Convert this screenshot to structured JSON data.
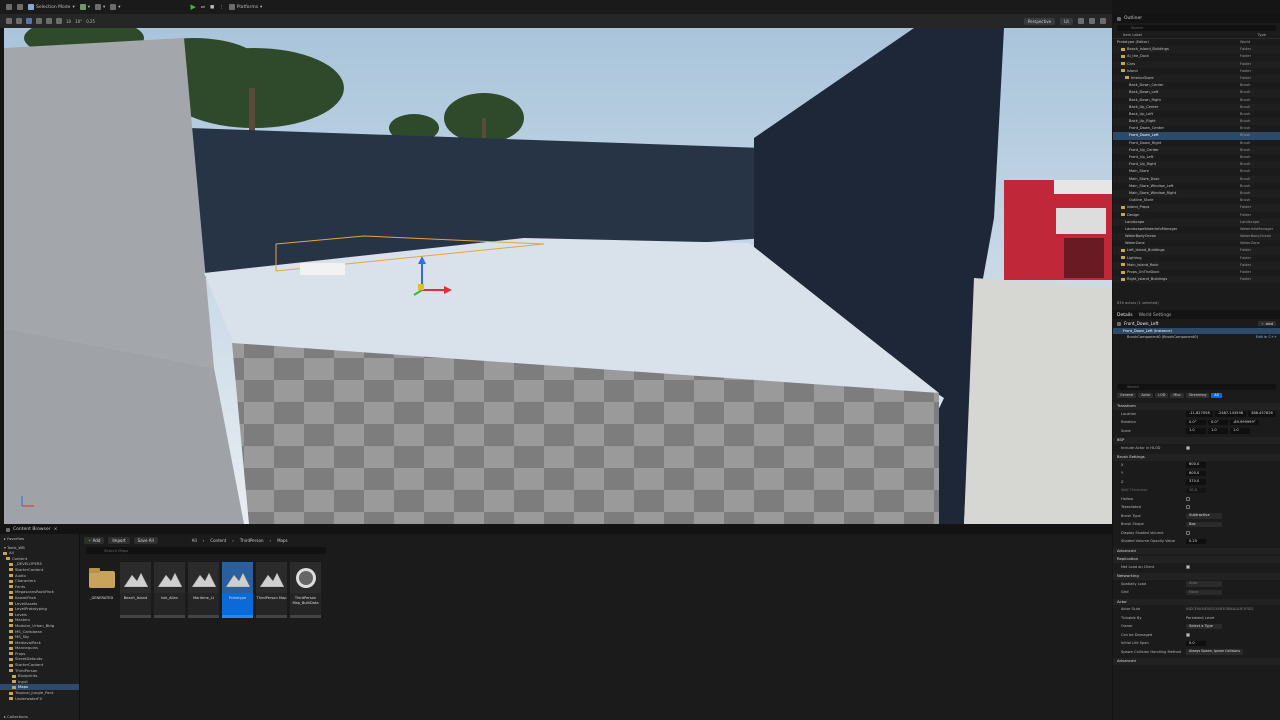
{
  "toolbar": {
    "mode": "Selection Mode",
    "platforms": "Platforms"
  },
  "viewport": {
    "perspective": "Perspective",
    "lit": "Lit",
    "snap_values": [
      "10",
      "10°",
      "0.25"
    ]
  },
  "content_browser": {
    "tab": "Content Browser",
    "add": "Add",
    "import": "Import",
    "save_all": "Save All",
    "crumbs": [
      "All",
      "Content",
      "ThirdPerson",
      "Maps"
    ],
    "search_placeholder": "Search Maps",
    "favorites": "Favorites",
    "project": "Tools_WB",
    "tree": [
      "All",
      "Content",
      "_DEVELOPERS",
      "StarterContent",
      "Audio",
      "Characters",
      "Fonts",
      "MegascansRockPack",
      "KawaiiPack",
      "LevelAssets",
      "LevelPrototyping",
      "Levels",
      "Masters",
      "Modular_Urban_Bldg",
      "MS_Caribbean",
      "MS_Sky",
      "MedievalPack",
      "Mannequins",
      "Props",
      "StreetDefaults",
      "StarterContent",
      "ThirdPerson",
      "Blueprints",
      "Input",
      "Maps",
      "Tropical_Jungle_Pack",
      "UnderwaterFX"
    ],
    "tree_selected_index": 24,
    "collections": "Collections",
    "assets": [
      {
        "label": "_GENERATED",
        "kind": "folder"
      },
      {
        "label": "Beach_Island",
        "kind": "map"
      },
      {
        "label": "Isle_Alien",
        "kind": "map"
      },
      {
        "label": "Maritime_Lt",
        "kind": "map"
      },
      {
        "label": "Prototype",
        "kind": "map",
        "selected": true
      },
      {
        "label": "ThirdPerson Map",
        "kind": "map"
      },
      {
        "label": "ThirdPerson Map_BuiltData",
        "kind": "data"
      }
    ]
  },
  "outliner": {
    "tab": "Outliner",
    "search_placeholder": "Search",
    "col_label": "Item Label",
    "col_type": "Type",
    "rows": [
      {
        "n": "Prototype (Editor)",
        "t": "World",
        "d": 0
      },
      {
        "n": "Beach_Island_Buildings",
        "t": "Folder",
        "d": 1
      },
      {
        "n": "AI_the_Dock",
        "t": "Folder",
        "d": 1
      },
      {
        "n": "Cars",
        "t": "Folder",
        "d": 1
      },
      {
        "n": "Island",
        "t": "Folder",
        "d": 1
      },
      {
        "n": "InteriorStore",
        "t": "Folder",
        "d": 2
      },
      {
        "n": "Back_Down_Center",
        "t": "Brush",
        "d": 3
      },
      {
        "n": "Back_Down_Left",
        "t": "Brush",
        "d": 3
      },
      {
        "n": "Back_Down_Right",
        "t": "Brush",
        "d": 3
      },
      {
        "n": "Back_Up_Center",
        "t": "Brush",
        "d": 3
      },
      {
        "n": "Back_Up_Left",
        "t": "Brush",
        "d": 3
      },
      {
        "n": "Back_Up_Right",
        "t": "Brush",
        "d": 3
      },
      {
        "n": "Front_Down_Center",
        "t": "Brush",
        "d": 3
      },
      {
        "n": "Front_Down_Left",
        "t": "Brush",
        "d": 3,
        "sel": true
      },
      {
        "n": "Front_Down_Right",
        "t": "Brush",
        "d": 3
      },
      {
        "n": "Front_Up_Center",
        "t": "Brush",
        "d": 3
      },
      {
        "n": "Front_Up_Left",
        "t": "Brush",
        "d": 3
      },
      {
        "n": "Front_Up_Right",
        "t": "Brush",
        "d": 3
      },
      {
        "n": "Main_Store",
        "t": "Brush",
        "d": 3
      },
      {
        "n": "Main_Store_Door",
        "t": "Brush",
        "d": 3
      },
      {
        "n": "Main_Store_Window_Left",
        "t": "Brush",
        "d": 3
      },
      {
        "n": "Main_Store_Window_Right",
        "t": "Brush",
        "d": 3
      },
      {
        "n": "Outline_Store",
        "t": "Brush",
        "d": 3
      },
      {
        "n": "Island_Props",
        "t": "Folder",
        "d": 1
      },
      {
        "n": "Design",
        "t": "Folder",
        "d": 1
      },
      {
        "n": "Landscape",
        "t": "Landscape",
        "d": 2
      },
      {
        "n": "LandscapeWaterInfoManager",
        "t": "WaterInfoManager",
        "d": 2
      },
      {
        "n": "WaterBodyOcean",
        "t": "WaterBodyOcean",
        "d": 2
      },
      {
        "n": "WaterZone",
        "t": "WaterZone",
        "d": 2
      },
      {
        "n": "Left_Island_Buildings",
        "t": "Folder",
        "d": 1
      },
      {
        "n": "Lighting",
        "t": "Folder",
        "d": 1
      },
      {
        "n": "Main_Island_Rock",
        "t": "Folder",
        "d": 1
      },
      {
        "n": "Props_OnTheDock",
        "t": "Folder",
        "d": 1
      },
      {
        "n": "Right_Island_Buildings",
        "t": "Folder",
        "d": 1
      }
    ],
    "footer": "630 actors (1 selected)"
  },
  "details": {
    "tab": "Details",
    "tab2": "World Settings",
    "actor": "Front_Down_Left",
    "add": "Add",
    "instance": "Front_Down_Left (Instance)",
    "component": "BrushComponent0 (BrushComponent0)",
    "edit_link": "Edit in C++",
    "search_placeholder": "Search",
    "filters": [
      "General",
      "Actor",
      "LOD",
      "Misc",
      "Streaming",
      "All"
    ],
    "transform": "Transform",
    "location_label": "Location",
    "location": [
      "-11.827058",
      "-2487.143598",
      "388.457826"
    ],
    "rotation_label": "Rotation",
    "rotation": [
      "0.0°",
      "0.0°",
      "-89.999999°"
    ],
    "scale_label": "Scale",
    "scale": [
      "1.0",
      "1.0",
      "1.0"
    ],
    "brush_sec": "BSP",
    "include_actor": "Include Actor in HLOD",
    "brush_settings": "Brush Settings",
    "x_label": "X",
    "x": "600.0",
    "y_label": "Y",
    "y": "600.0",
    "z_label": "Z",
    "z": "370.0",
    "wall_label": "Wall Thickness",
    "wall": "10.0",
    "hollow": "Hollow",
    "tessellated": "Tessellated",
    "brush_type_label": "Brush Type",
    "brush_type": "Subtractive",
    "shape_label": "Brush Shape",
    "shape": "Box",
    "display_label": "Display Shaded Volume",
    "opacity_label": "Shaded Volume Opacity Value",
    "opacity": "0.25",
    "advanced": "Advanced",
    "replication": "Replication",
    "net_load": "Net Load on Client",
    "networking": "Networking",
    "spatial_label": "Spatially Load",
    "spatial": "Auto",
    "grid_label": "Grid",
    "grid": "None",
    "actor_sec": "Actor",
    "guid_label": "Actor Guid",
    "guid": "64DCE9A34E0ED7A5D3C8B4A1A3E1F5D2",
    "tickable_label": "Tickable By",
    "tickable": "Persistent Level",
    "can_be_damaged": "Can be Damaged",
    "initial_life_label": "Initial Life Span",
    "initial_life": "0.0",
    "spawn_label": "Spawn Collision Handling Method",
    "spawn": "Always Spawn, Ignore Collisions",
    "advanced2": "Advanced",
    "owner_label": "Owner",
    "owner": "Select a Type"
  }
}
